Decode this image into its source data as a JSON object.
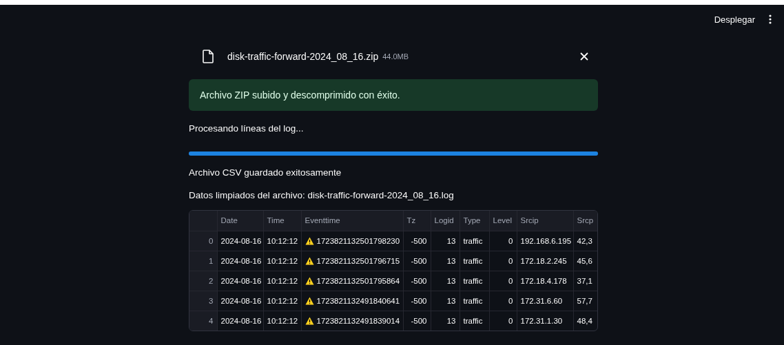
{
  "header": {
    "deploy_label": "Desplegar"
  },
  "upload": {
    "file_name": "disk-traffic-forward-2024_08_16.zip",
    "file_size": "44.0MB"
  },
  "alert": {
    "kind": "success",
    "text": "Archivo ZIP subido y descomprimido con éxito."
  },
  "status_text": "Procesando líneas del log...",
  "progress": {
    "level": 1.0
  },
  "saved_text": "Archivo CSV guardado exitosamente",
  "data_title": "Datos limpiados del archivo: disk-traffic-forward-2024_08_16.log",
  "table": {
    "columns": [
      "",
      "Date",
      "Time",
      "Eventtime",
      "Tz",
      "Logid",
      "Type",
      "Level",
      "Srcip",
      "Srcp"
    ],
    "rows": [
      {
        "warning": true,
        "cells": [
          "0",
          "2024-08-16",
          "10:12:12",
          "1723821132501798230",
          "-500",
          "13",
          "traffic",
          "0",
          "192.168.6.195",
          "42,3"
        ]
      },
      {
        "warning": true,
        "cells": [
          "1",
          "2024-08-16",
          "10:12:12",
          "1723821132501796715",
          "-500",
          "13",
          "traffic",
          "0",
          "172.18.2.245",
          "45,6"
        ]
      },
      {
        "warning": true,
        "cells": [
          "2",
          "2024-08-16",
          "10:12:12",
          "1723821132501795864",
          "-500",
          "13",
          "traffic",
          "0",
          "172.18.4.178",
          "37,1"
        ]
      },
      {
        "warning": true,
        "cells": [
          "3",
          "2024-08-16",
          "10:12:12",
          "1723821132491840641",
          "-500",
          "13",
          "traffic",
          "0",
          "172.31.6.60",
          "57,7"
        ]
      },
      {
        "warning": true,
        "cells": [
          "4",
          "2024-08-16",
          "10:12:12",
          "1723821132491839014",
          "-500",
          "13",
          "traffic",
          "0",
          "172.31.1.30",
          "48,4"
        ]
      }
    ]
  }
}
